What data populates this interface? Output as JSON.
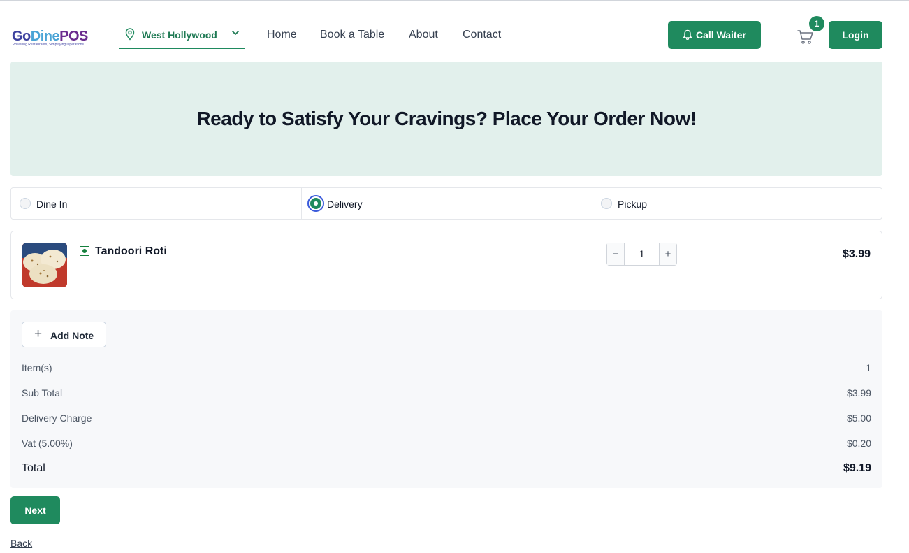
{
  "header": {
    "logo": {
      "go": "Go",
      "dine": "Dine",
      "pos": "POS",
      "tagline": "Powering Restaurants, Simplifying Operations"
    },
    "location": {
      "label": "West Hollywood",
      "icon": "map-pin-icon"
    },
    "nav": [
      "Home",
      "Book a Table",
      "About",
      "Contact"
    ],
    "call_waiter_label": "Call Waiter",
    "cart_count": "1",
    "login_label": "Login"
  },
  "hero": {
    "title": "Ready to Satisfy Your Cravings? Place Your Order Now!"
  },
  "order_types": {
    "options": [
      "Dine In",
      "Delivery",
      "Pickup"
    ],
    "selected": "Delivery"
  },
  "cart_items": [
    {
      "name": "Tandoori Roti",
      "quantity": "1",
      "price": "$3.99",
      "diet": "veg"
    }
  ],
  "summary": {
    "add_note_label": "Add Note",
    "rows": [
      {
        "label": "Item(s)",
        "value": "1"
      },
      {
        "label": "Sub Total",
        "value": "$3.99"
      },
      {
        "label": "Delivery Charge",
        "value": "$5.00"
      },
      {
        "label": "Vat (5.00%)",
        "value": "$0.20"
      }
    ],
    "total_label": "Total",
    "total_value": "$9.19"
  },
  "actions": {
    "next_label": "Next",
    "back_label": "Back"
  },
  "colors": {
    "accent": "#1f8a5e",
    "hero_bg": "#e2f0ec",
    "summary_bg": "#f7f8fa"
  }
}
